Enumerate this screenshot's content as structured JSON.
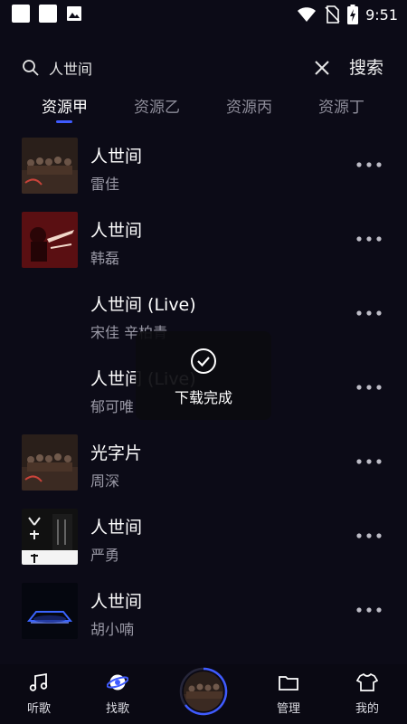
{
  "status_bar": {
    "time": "9:51",
    "icons": [
      "notification-square-icon",
      "notification-square-icon",
      "image-icon",
      "wifi-icon",
      "no-sim-icon",
      "battery-charging-icon"
    ]
  },
  "search": {
    "query": "人世间",
    "button_label": "搜索"
  },
  "tabs": [
    {
      "label": "资源甲",
      "active": true
    },
    {
      "label": "资源乙",
      "active": false
    },
    {
      "label": "资源丙",
      "active": false
    },
    {
      "label": "资源丁",
      "active": false
    }
  ],
  "songs": [
    {
      "title": "人世间",
      "artist": "雷佳",
      "cover": "group-photo"
    },
    {
      "title": "人世间",
      "artist": "韩磊",
      "cover": "red-poster"
    },
    {
      "title": "人世间 (Live)",
      "artist": "宋佳  辛柏青",
      "cover": "none"
    },
    {
      "title": "人世间 (Live)",
      "artist": "郁可唯",
      "cover": "none"
    },
    {
      "title": "光字片",
      "artist": "周深",
      "cover": "group-photo"
    },
    {
      "title": "人世间",
      "artist": "严勇",
      "cover": "calligraphy"
    },
    {
      "title": "人世间",
      "artist": "胡小喃",
      "cover": "blue-stage"
    }
  ],
  "toast": {
    "text": "下载完成",
    "icon": "check-circle-icon"
  },
  "bottom_nav": [
    {
      "label": "听歌",
      "icon": "music-note-icon"
    },
    {
      "label": "找歌",
      "icon": "planet-icon"
    },
    {
      "label": "管理",
      "icon": "folder-icon"
    },
    {
      "label": "我的",
      "icon": "shirt-icon"
    }
  ],
  "colors": {
    "background": "#0c0b17",
    "accent": "#3f5bff",
    "text_secondary": "#9a99a6",
    "tab_inactive": "#8d8c99"
  }
}
